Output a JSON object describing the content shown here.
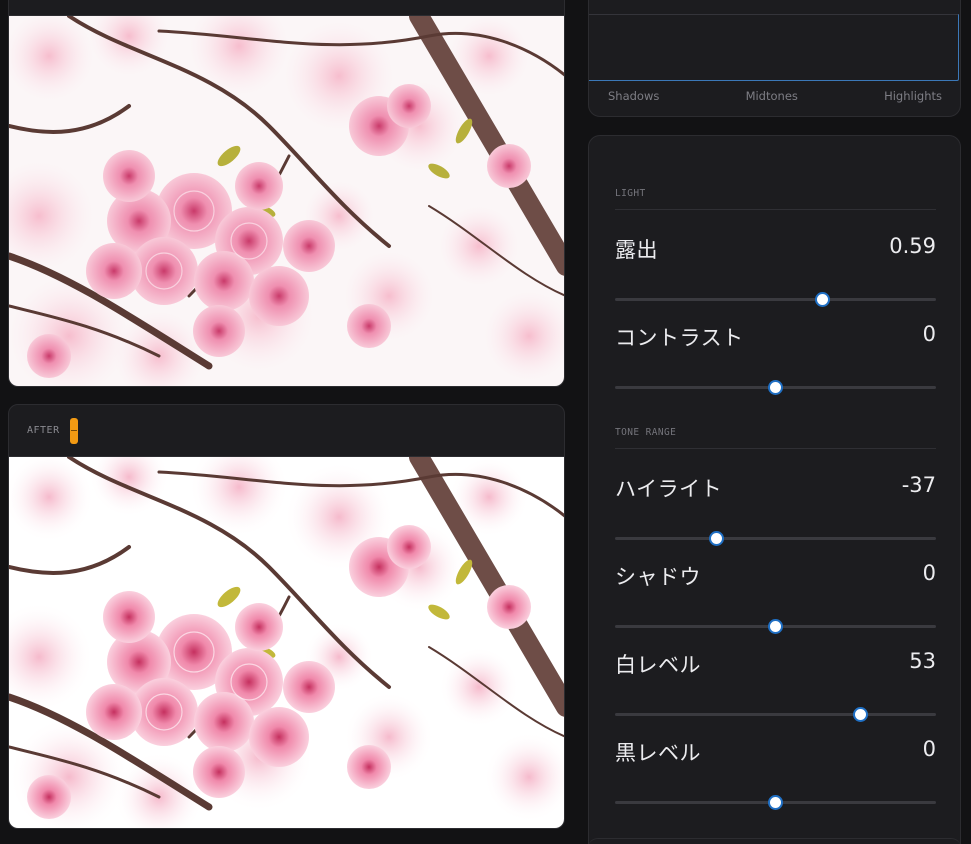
{
  "after_panel": {
    "label": "AFTER"
  },
  "tone_curve": {
    "labels": [
      "Shadows",
      "Midtones",
      "Highlights"
    ]
  },
  "adjustments": {
    "light": {
      "header": "LIGHT",
      "sliders": [
        {
          "label": "露出",
          "value": "0.59",
          "level": 0.59,
          "min": -2,
          "max": 2
        },
        {
          "label": "コントラスト",
          "value": "0",
          "level": 0,
          "min": -100,
          "max": 100
        }
      ]
    },
    "tone_range": {
      "header": "TONE RANGE",
      "sliders": [
        {
          "label": "ハイライト",
          "value": "-37",
          "level": -37,
          "min": -100,
          "max": 100
        },
        {
          "label": "シャドウ",
          "value": "0",
          "level": 0,
          "min": -100,
          "max": 100
        },
        {
          "label": "白レベル",
          "value": "53",
          "level": 53,
          "min": -100,
          "max": 100
        },
        {
          "label": "黒レベル",
          "value": "0",
          "level": 0,
          "min": -100,
          "max": 100
        }
      ]
    }
  },
  "colors": {
    "accent": "#1f6fc4",
    "after_marker": "#f29a13",
    "panel_bg": "#1c1c1f",
    "app_bg": "#121214"
  }
}
